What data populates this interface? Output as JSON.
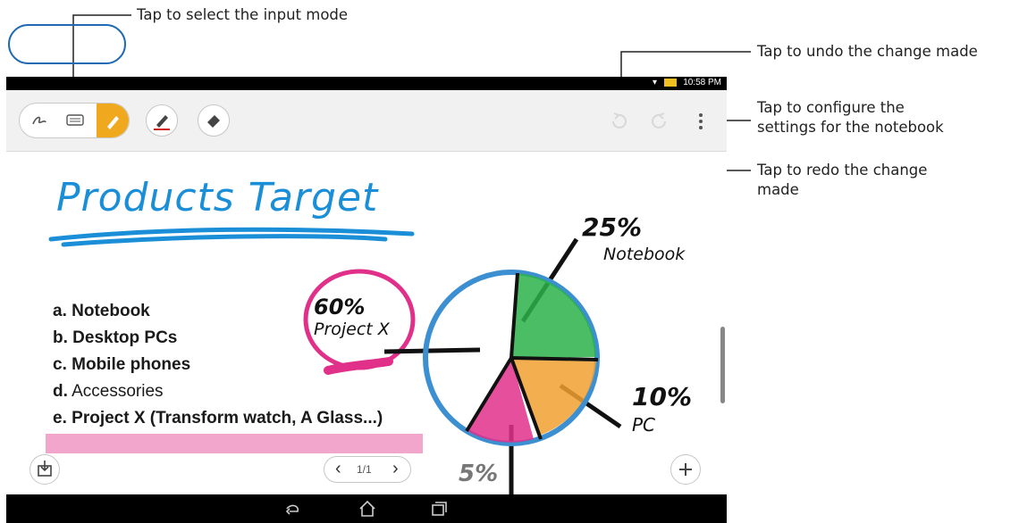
{
  "callouts": {
    "input_mode": "Tap to select the input mode",
    "undo": "Tap to undo the change made",
    "settings_line1": "Tap to configure the",
    "settings_line2": "settings for the notebook",
    "redo_line1": "Tap to redo the change",
    "redo_line2": "made"
  },
  "status_bar": {
    "time": "10:58 PM"
  },
  "note": {
    "title": "Products Target",
    "list": [
      {
        "prefix": "a.",
        "text": "Notebook",
        "bold": true
      },
      {
        "prefix": "b.",
        "text": "Desktop PCs",
        "bold": true
      },
      {
        "prefix": "c.",
        "text": "Mobile phones",
        "bold": true
      },
      {
        "prefix": "d.",
        "text": "Accessories",
        "bold": false
      },
      {
        "prefix": "e.",
        "text": "Project X (Transform watch, A Glass...)",
        "bold": true
      }
    ],
    "pie_labels": {
      "notebook_pct": "25%",
      "notebook": "Notebook",
      "projectx_pct": "60%",
      "projectx": "Project X",
      "pc_pct": "10%",
      "pc": "PC",
      "bottom_pct": "5%"
    }
  },
  "pager": {
    "label": "1/1",
    "prev": "‹",
    "next": "›"
  },
  "icons": {
    "handwriting": "handwriting-icon",
    "keyboard": "keyboard-icon",
    "draw": "pen-draw-icon",
    "pen_color": "pen-color-icon",
    "eraser": "eraser-icon",
    "undo": "undo-icon",
    "redo": "redo-icon",
    "more": "more-vert-icon",
    "import": "import-icon",
    "add": "add-icon"
  },
  "colors": {
    "accent_orange": "#f0a91e",
    "callout_blue": "#1f6ab3",
    "pie_green": "#2bb34a",
    "pie_orange": "#f0a030",
    "pie_pink": "#e0308a",
    "pie_ring": "#3c8fd0",
    "title_blue": "#1a8fd8",
    "highlighter_pink": "#f29cc7"
  }
}
